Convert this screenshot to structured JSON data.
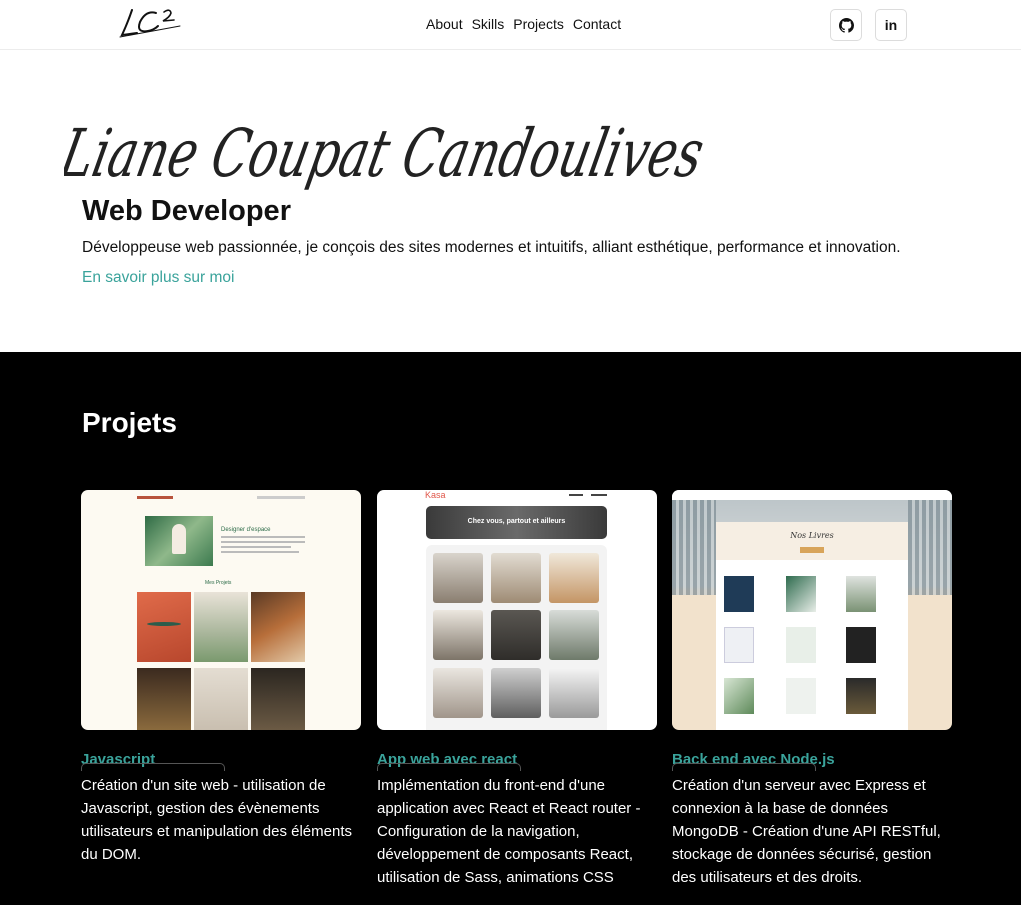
{
  "nav": {
    "logo_text": "LC²",
    "links": [
      "About",
      "Skills",
      "Projects",
      "Contact"
    ],
    "icons": [
      "github-icon",
      "linkedin-icon"
    ],
    "linkedin_label": "in"
  },
  "hero": {
    "signature": "Liane Coupat Candoulives",
    "role": "Web Developer",
    "intro": "Développeuse web passionnée, je conçois des sites modernes et intuitifs, alliant esthétique, performance et innovation.",
    "more_link": "En savoir plus sur moi"
  },
  "projects": {
    "title": "Projets",
    "cards": [
      {
        "title": "Javascript",
        "description": "Création d'un site web - utilisation de Javascript, gestion des évènements utilisateurs et manipulation des éléments du DOM.",
        "thumb": {
          "heading": "Designer d'espace",
          "section": "Mes Projets"
        }
      },
      {
        "title": "App web avec react",
        "description": "Implémentation du front-end d'une application avec React et React router - Configuration de la navigation, développement de composants React, utilisation de Sass, animations CSS",
        "thumb": {
          "brand": "Kasa",
          "banner": "Chez vous, partout et ailleurs"
        }
      },
      {
        "title": "Back end avec Node.js",
        "description": "Création d'un serveur avec Express et connexion à la base de données MongoDB - Création d'une API RESTful, stockage de données sécurisé, gestion des utilisateurs et des droits.",
        "thumb": {
          "banner": "Nos Livres"
        }
      }
    ]
  },
  "colors": {
    "accent": "#3aa39b",
    "dark": "#000000"
  }
}
